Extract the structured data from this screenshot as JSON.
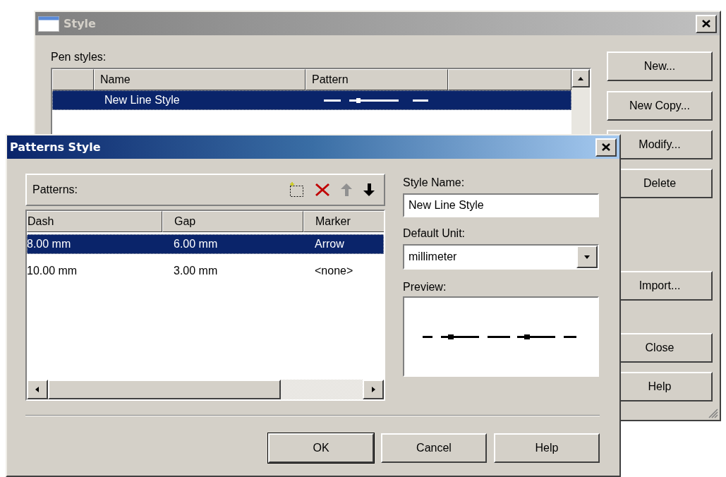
{
  "style_window": {
    "title": "Style",
    "pen_styles_label": "Pen styles:",
    "columns": [
      "Name",
      "Pattern"
    ],
    "rows": [
      {
        "name": "New Line Style",
        "selected": true
      }
    ],
    "buttons": [
      "New...",
      "New Copy...",
      "Modify...",
      "Delete",
      "Import...",
      "Close",
      "Help"
    ]
  },
  "patterns_window": {
    "title": "Patterns Style",
    "patterns_label": "Patterns:",
    "columns": [
      "Dash",
      "Gap",
      "Marker"
    ],
    "rows": [
      {
        "dash": "8.00 mm",
        "gap": "6.00 mm",
        "marker": "Arrow",
        "selected": true
      },
      {
        "dash": "10.00 mm",
        "gap": "3.00 mm",
        "marker": "<none>",
        "selected": false
      }
    ],
    "style_name_label": "Style Name:",
    "style_name": "New Line Style",
    "default_unit_label": "Default Unit:",
    "default_unit": "millimeter",
    "preview_label": "Preview:",
    "buttons": [
      {
        "label": "OK",
        "default": true
      },
      {
        "label": "Cancel",
        "default": false
      },
      {
        "label": "Help",
        "default": false
      }
    ]
  }
}
